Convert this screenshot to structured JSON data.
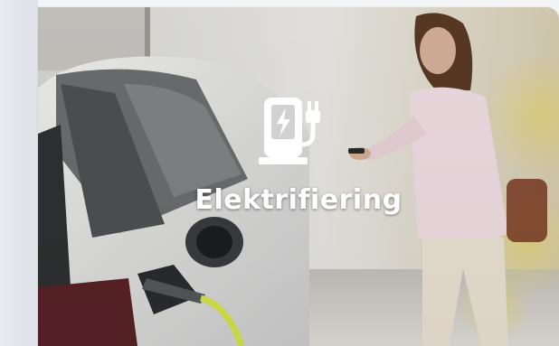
{
  "card": {
    "title": "Elektrifiering",
    "icon": "ev-charger-icon",
    "image": "electric-car-charging-photo"
  },
  "colors": {
    "label": "#ffffff",
    "icon": "#ffffff",
    "background": "#f2f4f6",
    "cable": "#d9e84a"
  }
}
